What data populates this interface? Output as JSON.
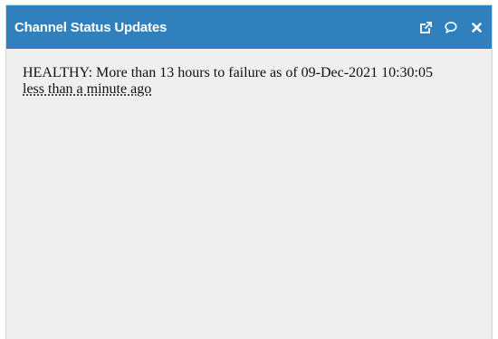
{
  "panel": {
    "title": "Channel Status Updates",
    "header_color": "#2f80bd",
    "icons": [
      "external-link-icon",
      "comment-icon",
      "close-icon"
    ]
  },
  "status": {
    "message": "HEALTHY: More than 13 hours to failure as of 09-Dec-2021 10:30:05",
    "time_ago": "less than a minute ago"
  }
}
